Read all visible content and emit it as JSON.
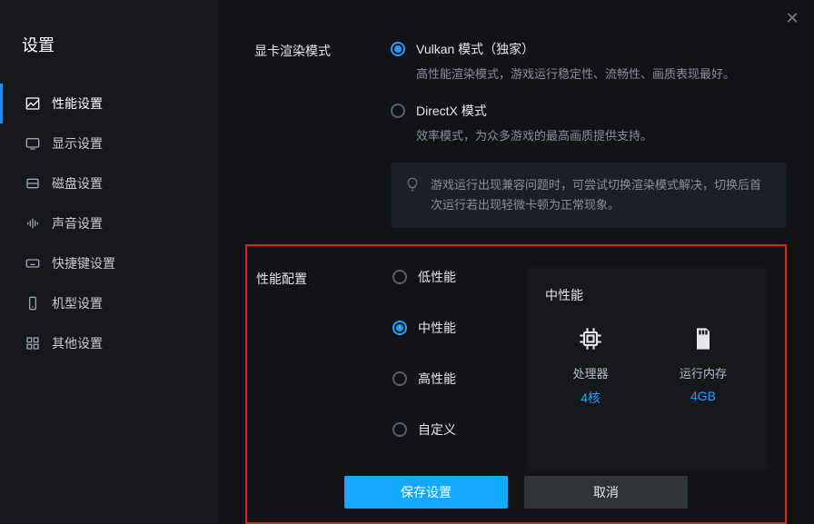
{
  "title": "设置",
  "sidebar": {
    "items": [
      {
        "icon": "chart",
        "label": "性能设置"
      },
      {
        "icon": "monitor",
        "label": "显示设置"
      },
      {
        "icon": "disk",
        "label": "磁盘设置"
      },
      {
        "icon": "sound",
        "label": "声音设置"
      },
      {
        "icon": "keyboard",
        "label": "快捷键设置"
      },
      {
        "icon": "phone",
        "label": "机型设置"
      },
      {
        "icon": "grid",
        "label": "其他设置"
      }
    ],
    "active_index": 0
  },
  "render_mode": {
    "label": "显卡渲染模式",
    "options": [
      {
        "title": "Vulkan 模式（独家）",
        "desc": "高性能渲染模式，游戏运行稳定性、流畅性、画质表现最好。",
        "selected": true
      },
      {
        "title": "DirectX 模式",
        "desc": "效率模式，为众多游戏的最高画质提供支持。",
        "selected": false
      }
    ],
    "tip": "游戏运行出现兼容问题时，可尝试切换渲染模式解决，切换后首次运行若出现轻微卡顿为正常现象。"
  },
  "performance": {
    "label": "性能配置",
    "options": [
      {
        "title": "低性能",
        "selected": false
      },
      {
        "title": "中性能",
        "selected": true
      },
      {
        "title": "高性能",
        "selected": false
      },
      {
        "title": "自定义",
        "selected": false
      }
    ],
    "card": {
      "title": "中性能",
      "cpu": {
        "label": "处理器",
        "value": "4核"
      },
      "ram": {
        "label": "运行内存",
        "value": "4GB"
      }
    }
  },
  "footer": {
    "save": "保存设置",
    "cancel": "取消"
  }
}
